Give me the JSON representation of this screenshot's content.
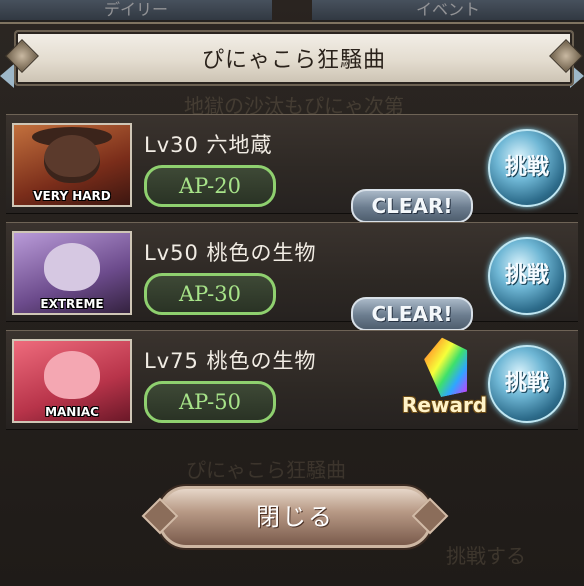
{
  "background": {
    "tabs": [
      "デイリー",
      "イベント"
    ],
    "faint_texts": [
      "地獄の沙汰もぴにゃ次第",
      "ぴにゃこら狂騒曲",
      "挑戦する"
    ]
  },
  "dialog": {
    "title": "ぴにゃこら狂騒曲",
    "quests": [
      {
        "level_name": "Lv30 六地蔵",
        "difficulty": "VERY HARD",
        "ap": "AP-20",
        "status": "CLEAR!",
        "action": "挑戦"
      },
      {
        "level_name": "Lv50 桃色の生物",
        "difficulty": "EXTREME",
        "ap": "AP-30",
        "status": "CLEAR!",
        "action": "挑戦"
      },
      {
        "level_name": "Lv75 桃色の生物",
        "difficulty": "MANIAC",
        "ap": "AP-50",
        "reward": "Reward",
        "action": "挑戦"
      }
    ],
    "close_label": "閉じる"
  },
  "colors": {
    "ap_border": "#8fd06f",
    "challenge_button": "#2d6c8b",
    "very_hard": "#c2703d",
    "extreme": "#b99bd8",
    "maniac": "#ee6b7c"
  }
}
